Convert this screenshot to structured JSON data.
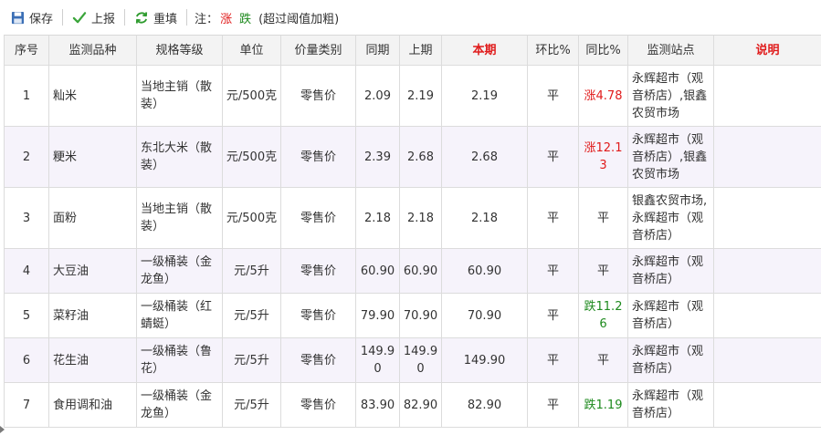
{
  "toolbar": {
    "save_label": "保存",
    "report_label": "上报",
    "refill_label": "重填",
    "note_prefix": "注：",
    "note_up": "涨",
    "note_down": "跌",
    "note_hint": "(超过阈值加粗)"
  },
  "colors": {
    "up": "#e01b1b",
    "down": "#1e8a1e",
    "header_bg": "#f3f3f3",
    "stripe": "#f6f3fb"
  },
  "columns": [
    "序号",
    "监测品种",
    "规格等级",
    "单位",
    "价量类别",
    "同期",
    "上期",
    "本期",
    "环比%",
    "同比%",
    "监测站点",
    "说明"
  ],
  "rows": [
    {
      "no": "1",
      "item": "籼米",
      "spec": "当地主销（散装）",
      "unit": "元/500克",
      "type": "零售价",
      "same": "2.09",
      "prev": "2.19",
      "cur": "2.19",
      "mom": "平",
      "yoy": "涨4.78",
      "yoy_dir": "up",
      "site": "永辉超市（观音桥店）,银鑫农贸市场",
      "desc": ""
    },
    {
      "no": "2",
      "item": "粳米",
      "spec": "东北大米（散装）",
      "unit": "元/500克",
      "type": "零售价",
      "same": "2.39",
      "prev": "2.68",
      "cur": "2.68",
      "mom": "平",
      "yoy": "涨12.13",
      "yoy_dir": "up",
      "site": "永辉超市（观音桥店）,银鑫农贸市场",
      "desc": ""
    },
    {
      "no": "3",
      "item": "面粉",
      "spec": "当地主销（散装）",
      "unit": "元/500克",
      "type": "零售价",
      "same": "2.18",
      "prev": "2.18",
      "cur": "2.18",
      "mom": "平",
      "yoy": "平",
      "yoy_dir": "flat",
      "site": "银鑫农贸市场,永辉超市（观音桥店）",
      "desc": ""
    },
    {
      "no": "4",
      "item": "大豆油",
      "spec": "一级桶装（金龙鱼）",
      "unit": "元/5升",
      "type": "零售价",
      "same": "60.90",
      "prev": "60.90",
      "cur": "60.90",
      "mom": "平",
      "yoy": "平",
      "yoy_dir": "flat",
      "site": "永辉超市（观音桥店）",
      "desc": ""
    },
    {
      "no": "5",
      "item": "菜籽油",
      "spec": "一级桶装（红蜻蜓）",
      "unit": "元/5升",
      "type": "零售价",
      "same": "79.90",
      "prev": "70.90",
      "cur": "70.90",
      "mom": "平",
      "yoy": "跌11.26",
      "yoy_dir": "down",
      "site": "永辉超市（观音桥店）",
      "desc": ""
    },
    {
      "no": "6",
      "item": "花生油",
      "spec": "一级桶装（鲁花）",
      "unit": "元/5升",
      "type": "零售价",
      "same": "149.90",
      "prev": "149.90",
      "cur": "149.90",
      "mom": "平",
      "yoy": "平",
      "yoy_dir": "flat",
      "site": "永辉超市（观音桥店）",
      "desc": ""
    },
    {
      "no": "7",
      "item": "食用调和油",
      "spec": "一级桶装（金龙鱼）",
      "unit": "元/5升",
      "type": "零售价",
      "same": "83.90",
      "prev": "82.90",
      "cur": "82.90",
      "mom": "平",
      "yoy": "跌1.19",
      "yoy_dir": "down",
      "site": "永辉超市（观音桥店）",
      "desc": ""
    }
  ]
}
